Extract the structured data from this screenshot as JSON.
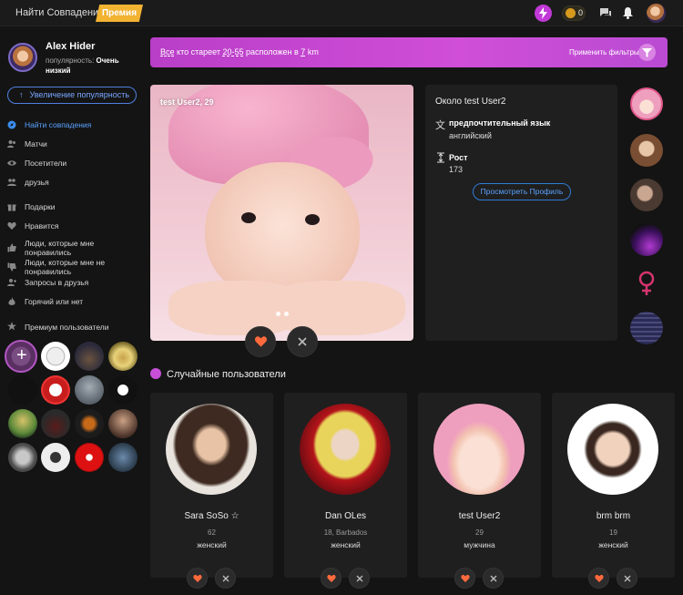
{
  "topbar": {
    "title": "Найти Совпадения",
    "premium": "Премия",
    "coins": "0"
  },
  "profile": {
    "name": "Alex Hider",
    "popularity_label": "популярность:",
    "popularity_value": "Очень низкий",
    "boost_button": "Увеличение популярность"
  },
  "nav": [
    {
      "label": "Найти совпадения",
      "icon": "compass-icon",
      "active": true
    },
    {
      "label": "Матчи",
      "icon": "users-icon"
    },
    {
      "label": "Посетители",
      "icon": "eye-icon"
    },
    {
      "label": "друзья",
      "icon": "friends-icon"
    },
    {
      "label": "Подарки",
      "icon": "gift-icon"
    },
    {
      "label": "Нравится",
      "icon": "heart-icon"
    },
    {
      "label": "Люди, которые мне понравились",
      "icon": "thumbs-up-icon"
    },
    {
      "label": "Люди, которые мне не понравились",
      "icon": "thumbs-down-icon"
    },
    {
      "label": "Запросы в друзья",
      "icon": "user-add-icon"
    },
    {
      "label": "Горячий или нет",
      "icon": "flame-icon"
    }
  ],
  "premium_users_label": "Премиум пользователи",
  "filter": {
    "prefix": "Все",
    "mid1": "кто стареет",
    "age": "20-55",
    "mid2": "расположен в",
    "distance": "7",
    "unit": "km",
    "apply_label": "Применить фильтры"
  },
  "current": {
    "name": "test User2,",
    "age": "29"
  },
  "about": {
    "title": "Около test User2",
    "language_label": "предпочтительный язык",
    "language_value": "английский",
    "height_label": "Рост",
    "height_value": "173",
    "view_profile": "Просмотреть Профиль"
  },
  "random_users_title": "Случайные пользователи",
  "random_users": [
    {
      "name": "Sara SoSo ☆",
      "sub": "62",
      "gender": "женский"
    },
    {
      "name": "Dan OLes",
      "sub": "18, Barbados",
      "gender": "женский"
    },
    {
      "name": "test User2",
      "sub": "29",
      "gender": "мужчина"
    },
    {
      "name": "brm brm",
      "sub": "19",
      "gender": "женский"
    }
  ],
  "colors": {
    "accent_purple": "#c239d8",
    "link_blue": "#5aa2ff",
    "like_orange": "#ff6a3d"
  }
}
